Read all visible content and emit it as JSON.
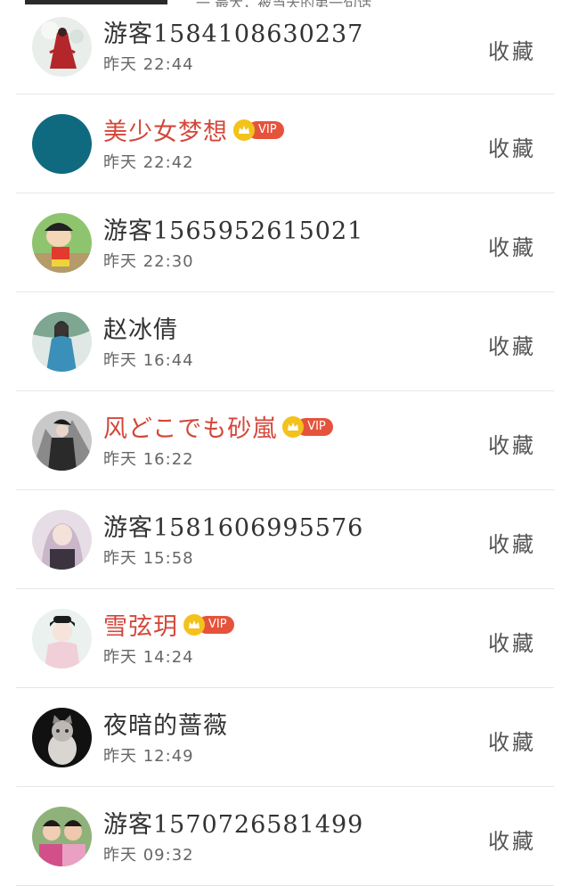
{
  "header_fragment": "一 最大，被当天的第一句话",
  "vip_label": "VIP",
  "items": [
    {
      "name": "游客15841086302​37",
      "time": "昨天 22:44",
      "action": "收藏",
      "vip": false,
      "avatar": "avatar-red-dress-icon"
    },
    {
      "name": "美少女梦想",
      "time": "昨天 22:42",
      "action": "收藏",
      "vip": true,
      "avatar": "avatar-teal-circle-icon"
    },
    {
      "name": "游客1565952615021",
      "time": "昨天 22:30",
      "action": "收藏",
      "vip": false,
      "avatar": "avatar-cartoon-icon"
    },
    {
      "name": "赵冰倩",
      "time": "昨天 16:44",
      "action": "收藏",
      "vip": false,
      "avatar": "avatar-woman-blue-icon"
    },
    {
      "name": "风どこでも砂嵐",
      "time": "昨天 16:22",
      "action": "收藏",
      "vip": true,
      "avatar": "avatar-warrior-icon"
    },
    {
      "name": "游客1581606995576",
      "time": "昨天 15:58",
      "action": "收藏",
      "vip": false,
      "avatar": "avatar-anime-girl-icon"
    },
    {
      "name": "雪弦玥",
      "time": "昨天 14:24",
      "action": "收藏",
      "vip": true,
      "avatar": "avatar-hanfu-girl-icon"
    },
    {
      "name": "夜暗的蔷薇",
      "time": "昨天 12:49",
      "action": "收藏",
      "vip": false,
      "avatar": "avatar-cat-icon"
    },
    {
      "name": "游客1570726581499",
      "time": "昨天 09:32",
      "action": "收藏",
      "vip": false,
      "avatar": "avatar-children-icon"
    }
  ],
  "colors": {
    "vip_name": "#d4473a",
    "normal_name": "#333333",
    "vip_pill": "#e5533c",
    "crown": "#f3c21c",
    "divider": "#e6e6e6"
  }
}
